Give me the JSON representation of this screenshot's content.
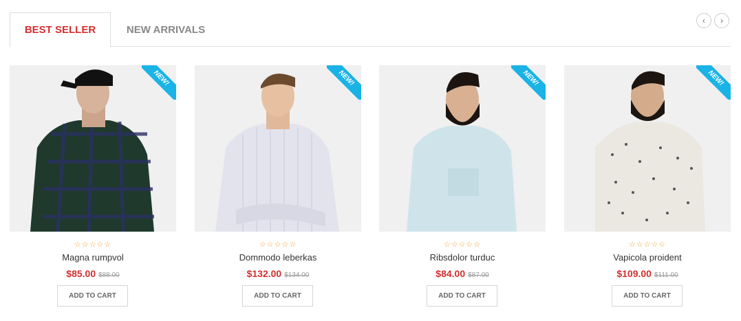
{
  "tabs": [
    {
      "label": "BEST SELLER",
      "active": true
    },
    {
      "label": "NEW ARRIVALS",
      "active": false
    }
  ],
  "carousel": {
    "prev_icon": "‹",
    "next_icon": "›"
  },
  "colors": {
    "accent": "#d32f2f",
    "badge": "#1ab3e6",
    "stars": "#f0a030"
  },
  "products": [
    {
      "name": "Magna rumpvol",
      "price": "$85.00",
      "old_price": "$88.00",
      "badge": "NEW!",
      "rating": "☆☆☆☆☆",
      "cart_label": "ADD TO CART"
    },
    {
      "name": "Dommodo leberkas",
      "price": "$132.00",
      "old_price": "$134.00",
      "badge": "NEW!",
      "rating": "☆☆☆☆☆",
      "cart_label": "ADD TO CART"
    },
    {
      "name": "Ribsdolor turduc",
      "price": "$84.00",
      "old_price": "$87.00",
      "badge": "NEW!",
      "rating": "☆☆☆☆☆",
      "cart_label": "ADD TO CART"
    },
    {
      "name": "Vapicola proident",
      "price": "$109.00",
      "old_price": "$111.00",
      "badge": "NEW!",
      "rating": "☆☆☆☆☆",
      "cart_label": "ADD TO CART"
    }
  ]
}
